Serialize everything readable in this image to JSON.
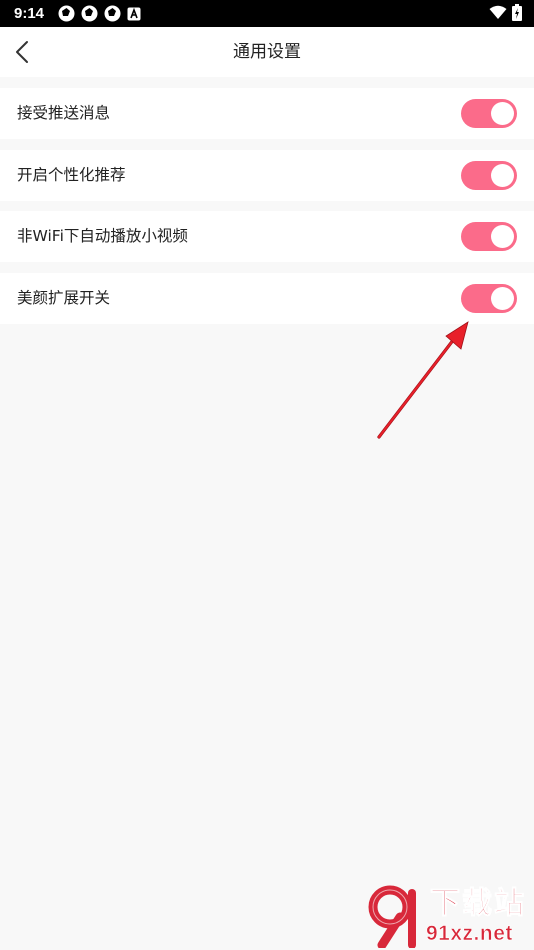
{
  "status_bar": {
    "time": "9:14",
    "left_icons": [
      "aperture-icon",
      "aperture-icon",
      "aperture-icon",
      "a-box-icon"
    ],
    "right_icons": [
      "wifi-icon",
      "battery-charging-icon"
    ]
  },
  "header": {
    "back_icon": "chevron-left-icon",
    "title": "通用设置"
  },
  "settings": [
    {
      "label": "接受推送消息",
      "enabled": true
    },
    {
      "label": "开启个性化推荐",
      "enabled": true
    },
    {
      "label": "非WiFi下自动播放小视频",
      "enabled": true
    },
    {
      "label": "美颜扩展开关",
      "enabled": true
    }
  ],
  "annotation": {
    "type": "arrow",
    "points_to": "美颜扩展开关",
    "color": "#e8202a"
  },
  "watermark": {
    "title": "下载站",
    "domain": "91xz.net",
    "logo_text": "9"
  },
  "colors": {
    "toggle_on": "#fb6b8a",
    "background": "#f8f8f8",
    "row_background": "#ffffff",
    "status_bar": "#000000"
  }
}
